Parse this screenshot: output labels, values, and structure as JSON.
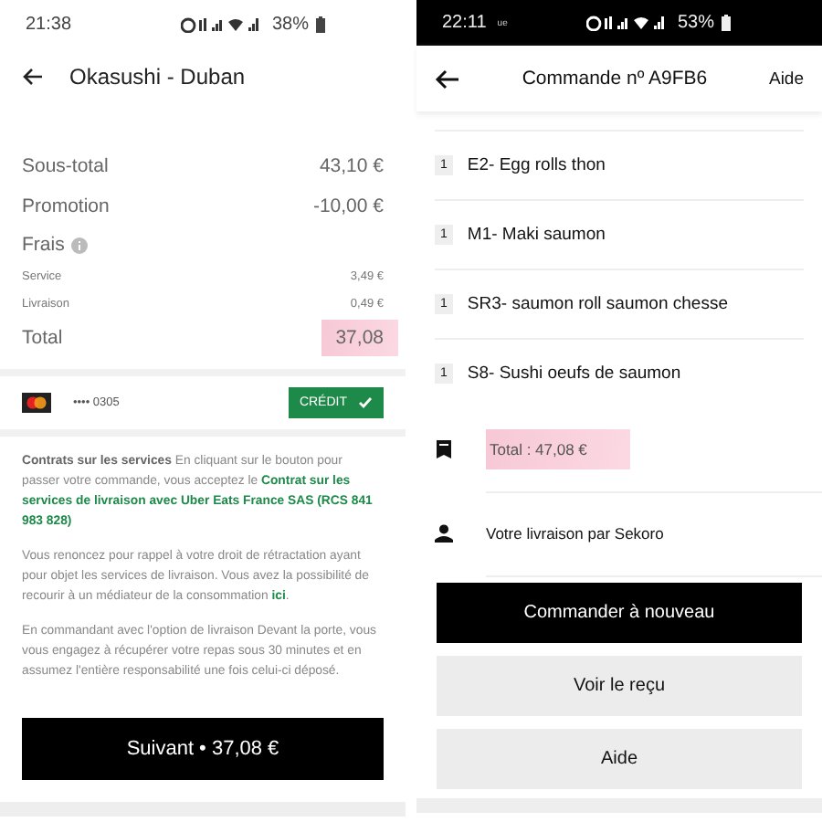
{
  "checkout": {
    "status_bar": {
      "time": "21:38",
      "battery": "38%"
    },
    "title": "Okasushi - Duban",
    "summary": [
      {
        "label": "Sous-total",
        "value": "43,10 €",
        "kind": "main"
      },
      {
        "label": "Promotion",
        "value": "-10,00 €",
        "kind": "main"
      },
      {
        "label": "Frais",
        "kind": "heading"
      },
      {
        "label": "Service",
        "value": "3,49 €",
        "kind": "sub"
      },
      {
        "label": "Livraison",
        "value": "0,49 €",
        "kind": "sub"
      },
      {
        "label": "Total",
        "value": "37,08",
        "kind": "main",
        "highlighted": true
      }
    ],
    "payment": {
      "card": "•••• 0305",
      "button": "CRÉDIT",
      "selected": true
    },
    "legal": [
      [
        {
          "text": "Contrats sur les services",
          "kind": "bold"
        },
        {
          "text": " En cliquant sur le bouton pour passer votre commande, vous acceptez le ",
          "kind": "plain"
        },
        {
          "text": "Contrat sur les services de livraison avec Uber Eats France SAS (RCS 841 983 828)",
          "kind": "green"
        }
      ],
      [
        {
          "text": "Vous renoncez pour rappel à votre droit de rétractation ayant pour objet les services de livraison. Vous avez la possibilité de recourir à un médiateur de la consommation ",
          "kind": "plain"
        },
        {
          "text": "ici",
          "kind": "link"
        },
        {
          "text": ".",
          "kind": "plain"
        }
      ],
      [
        {
          "text": "En commandant avec l'option de livraison Devant la porte, vous vous engagez à récupérer votre repas sous 30 minutes et en assumez l'entière responsabilité une fois celui-ci déposé.",
          "kind": "plain"
        }
      ]
    ],
    "next_button": "Suivant • 37,08 €"
  },
  "order": {
    "status_bar": {
      "time": "22:11",
      "carrier": "ue",
      "battery": "53%"
    },
    "title": "Commande nº A9FB6",
    "help": "Aide",
    "items": [
      {
        "qty": "1",
        "name": "E2- Egg rolls thon"
      },
      {
        "qty": "1",
        "name": "M1- Maki saumon"
      },
      {
        "qty": "1",
        "name": "SR3- saumon roll saumon chesse"
      },
      {
        "qty": "1",
        "name": "S8- Sushi oeufs de saumon"
      }
    ],
    "details": [
      {
        "kind": "receipt",
        "text": "Total : 47,08 €",
        "highlighted": true
      },
      {
        "kind": "person",
        "text": "Votre livraison par Sekoro",
        "highlighted": false
      }
    ],
    "buttons": [
      {
        "label": "Commander à nouveau",
        "kind": "primary"
      },
      {
        "label": "Voir le reçu",
        "kind": "secondary"
      },
      {
        "label": "Aide",
        "kind": "secondary"
      }
    ]
  }
}
